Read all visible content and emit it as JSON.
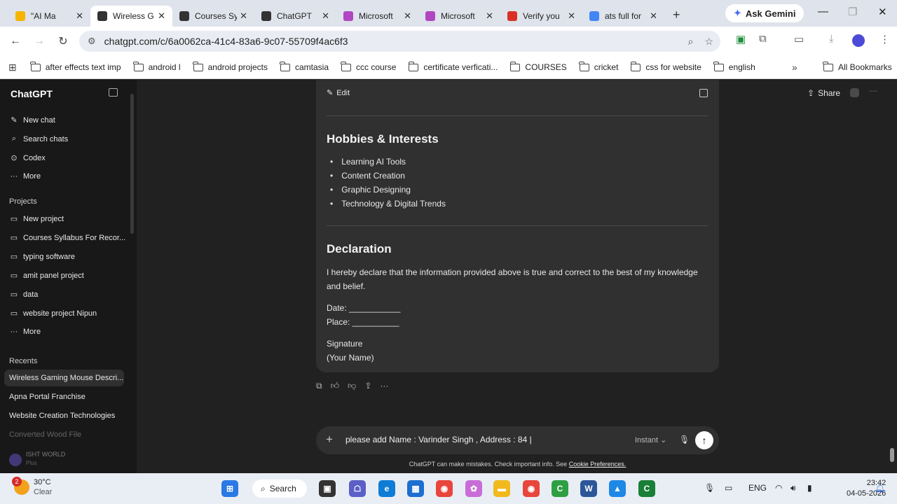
{
  "browser": {
    "tabs": [
      {
        "title": "\"AI Ma",
        "color": "#f4b400",
        "icon": "docs-icon"
      },
      {
        "title": "Wireless G",
        "color": "#333333",
        "icon": "chatgpt-icon"
      },
      {
        "title": "Courses Sy",
        "color": "#333333",
        "icon": "chatgpt-icon"
      },
      {
        "title": "ChatGPT",
        "color": "#333333",
        "icon": "chatgpt-icon"
      },
      {
        "title": "Microsoft",
        "color": "#b146c2",
        "icon": "copilot-icon"
      },
      {
        "title": "Microsoft",
        "color": "#b146c2",
        "icon": "copilot-icon"
      },
      {
        "title": "Verify you",
        "color": "#d93025",
        "icon": "gmail-icon"
      },
      {
        "title": "ats full for",
        "color": "#4285f4",
        "icon": "google-icon"
      }
    ],
    "ask_gemini": "Ask Gemini",
    "url": "chatgpt.com/c/6a0062ca-41c4-83a6-9c07-55709f4ac6f3",
    "bookmarks": [
      "after effects text imp",
      "android l",
      "android projects",
      "camtasia",
      "ccc course",
      "certificate verficati...",
      "COURSES",
      "cricket",
      "css for website",
      "english"
    ],
    "all_bookmarks": "All Bookmarks"
  },
  "sidebar": {
    "logo": "ChatGPT",
    "nav": [
      {
        "label": "New chat",
        "icon": "pencil-icon"
      },
      {
        "label": "Search chats",
        "icon": "search-icon"
      },
      {
        "label": "Codex",
        "icon": "codex-icon"
      },
      {
        "label": "More",
        "icon": "more-icon"
      }
    ],
    "projects_heading": "Projects",
    "projects": [
      {
        "label": "New project",
        "icon": "folder-plus-icon"
      },
      {
        "label": "Courses Syllabus For Recor...",
        "icon": "folder-icon"
      },
      {
        "label": "typing software",
        "icon": "folder-icon"
      },
      {
        "label": "amit panel project",
        "icon": "folder-icon"
      },
      {
        "label": "data",
        "icon": "folder-icon"
      },
      {
        "label": "website project Nipun",
        "icon": "folder-icon"
      },
      {
        "label": "More",
        "icon": "more-icon"
      }
    ],
    "recents_heading": "Recents",
    "recents": [
      "Wireless Gaming Mouse Descri...",
      "Apna Portal Franchise",
      "Website Creation Technologies",
      "Converted Wood File"
    ],
    "user_name": "ISHT WORLD",
    "user_plan": "Plus"
  },
  "chat": {
    "edit_label": "Edit",
    "share_label": "Share",
    "hobbies_heading": "Hobbies & Interests",
    "hobbies": [
      "Learning AI Tools",
      "Content Creation",
      "Graphic Designing",
      "Technology & Digital Trends"
    ],
    "declaration_heading": "Declaration",
    "declaration_text": "I hereby declare that the information provided above is true and correct to the best of my knowledge and belief.",
    "date_line": "Date: ___________",
    "place_line": "Place: __________",
    "signature": "Signature",
    "your_name": "(Your Name)"
  },
  "composer": {
    "text": "please add Name : Varinder Singh , Address : 84 |",
    "mode": "Instant",
    "disclaimer": "ChatGPT can make mistakes. Check important info. See",
    "disclaimer_link": "Cookie Preferences."
  },
  "taskbar": {
    "temperature": "30°C",
    "weather": "Clear",
    "weather_badge": "2",
    "search_label": "Search",
    "language": "ENG",
    "time": "23:42",
    "date": "04-05-2026"
  }
}
